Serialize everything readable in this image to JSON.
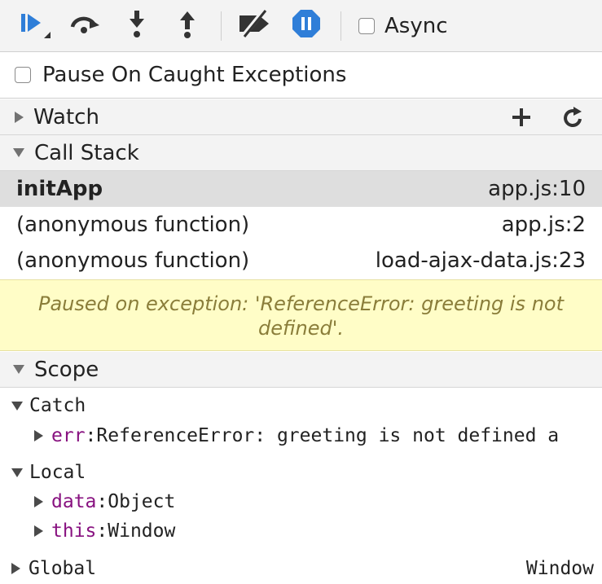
{
  "toolbar": {
    "resume_icon": "resume-icon",
    "step_over_icon": "step-over-icon",
    "step_into_icon": "step-into-icon",
    "step_out_icon": "step-out-icon",
    "deactivate_breakpoints_icon": "deactivate-breakpoints-icon",
    "pause_on_exceptions_icon": "pause-on-exceptions-icon",
    "async_label": "Async",
    "accent_color": "#2f7ed8"
  },
  "pause_on_caught": {
    "label": "Pause On Caught Exceptions"
  },
  "watch": {
    "title": "Watch",
    "add_icon": "plus-icon",
    "refresh_icon": "refresh-icon"
  },
  "call_stack": {
    "title": "Call Stack",
    "frames": [
      {
        "name": "initApp",
        "location": "app.js:10",
        "selected": true
      },
      {
        "name": "(anonymous function)",
        "location": "app.js:2",
        "selected": false
      },
      {
        "name": "(anonymous function)",
        "location": "load-ajax-data.js:23",
        "selected": false
      }
    ]
  },
  "paused_message": {
    "line1": "Paused on exception: 'ReferenceError: greeting is not",
    "line2": "defined'."
  },
  "scope": {
    "title": "Scope",
    "catch": {
      "label": "Catch",
      "err_key": "err",
      "err_value": "ReferenceError: greeting is not defined a"
    },
    "local": {
      "label": "Local",
      "items": [
        {
          "key": "data",
          "value": "Object"
        },
        {
          "key": "this",
          "value": "Window"
        }
      ]
    },
    "global": {
      "label": "Global",
      "value": "Window"
    }
  }
}
